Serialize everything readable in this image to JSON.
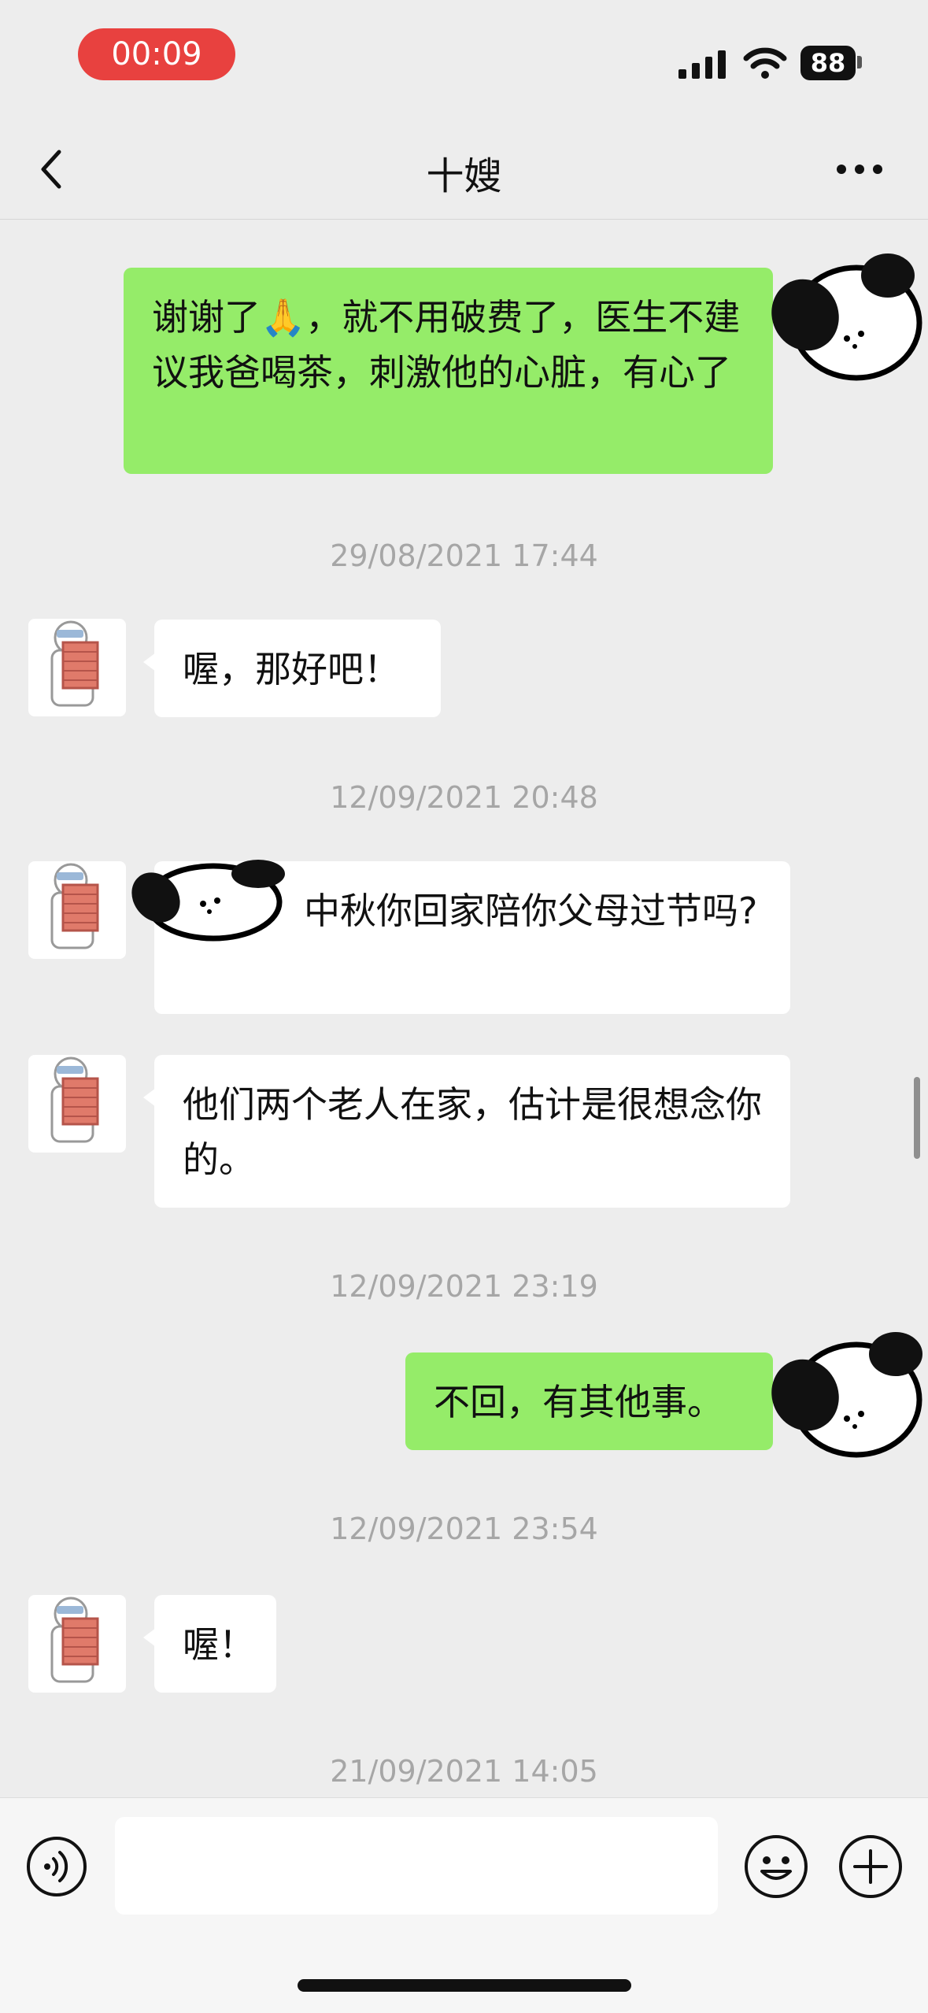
{
  "status_bar": {
    "recording_time": "00:09",
    "battery": "88"
  },
  "nav": {
    "title": "十嫂"
  },
  "messages": [
    {
      "side": "me",
      "text": "谢谢了🙏，就不用破费了，医生不建议我爸喝茶，刺激他的心脏，有心了"
    },
    {
      "side": "timestamp",
      "text": "29/08/2021 17:44"
    },
    {
      "side": "them",
      "text": "喔，那好吧！"
    },
    {
      "side": "timestamp",
      "text": "12/09/2021 20:48"
    },
    {
      "side": "them",
      "text": "中秋你回家陪你父母过节吗?"
    },
    {
      "side": "them",
      "text": "他们两个老人在家，估计是很想念你的。"
    },
    {
      "side": "timestamp",
      "text": "12/09/2021 23:19"
    },
    {
      "side": "me",
      "text": "不回，有其他事。"
    },
    {
      "side": "timestamp",
      "text": "12/09/2021 23:54"
    },
    {
      "side": "them",
      "text": "喔！"
    },
    {
      "side": "timestamp",
      "text": "21/09/2021 14:05"
    }
  ],
  "input": {
    "placeholder": ""
  },
  "icons": {
    "back": "chevron-left-icon",
    "more": "more-horizontal-icon",
    "voice": "voice-icon",
    "emoji": "emoji-icon",
    "plus": "plus-icon"
  },
  "colors": {
    "background": "#ededed",
    "my_bubble": "#95ec69",
    "their_bubble": "#ffffff",
    "timestamp": "#a6a6a6",
    "recording_pill": "#e8413f"
  }
}
